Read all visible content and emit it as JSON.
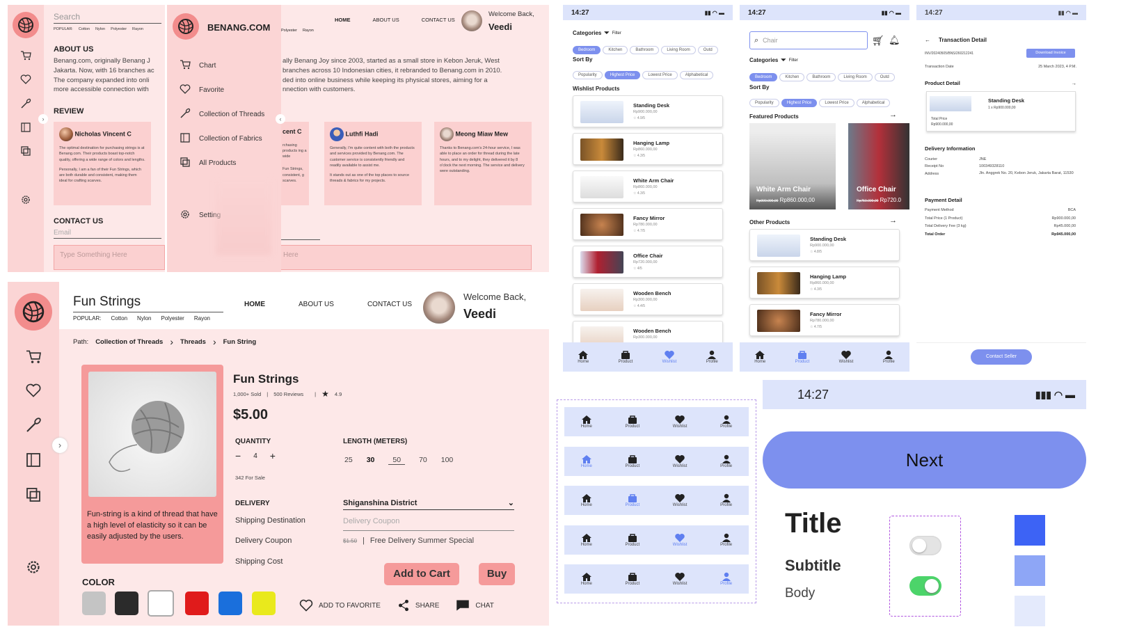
{
  "colors": {
    "pink_sidebar": "#fbd5d5",
    "pink_bg": "#fde8e8",
    "logo": "#f28c8c",
    "accent_blue": "#7d90ee",
    "nav_bg": "#dde4fb",
    "button_red": "#f59a9a"
  },
  "p1": {
    "search_placeholder": "Search",
    "popular": [
      "POPULAR:",
      "Cotton",
      "Nylon",
      "Polyester",
      "Rayon"
    ],
    "about_title": "ABOUT US",
    "about_text": "Benang.com, originally Benang J",
    "about_text2": "Jakarta. Now, with 16 branches ac",
    "about_text3": "The company expanded into onli",
    "about_text4": "more accessible connection with",
    "review_title": "REVIEW",
    "reviewer1": "Nicholas Vincent C",
    "review1_text": "The optimal destination for purchasing strings is at Benang.com. Their products boast top-notch quality, offering a wide range of colors and lengths.",
    "review1_text2": "Personally, I am a fan of their Fun Strings, which are both durable and consistent, making them ideal for crafting scarves.",
    "contact_title": "CONTACT US",
    "email_placeholder": "Email",
    "message_placeholder": "Type Something Here"
  },
  "p2": {
    "brand": "BENANG.COM",
    "menu": [
      "Chart",
      "Favorite",
      "Collection of Threads",
      "Collection of Fabrics",
      "All Products"
    ],
    "setting": "Setting",
    "popular": [
      "Polyester",
      "Rayon"
    ],
    "nav": [
      "HOME",
      "ABOUT US",
      "CONTACT US"
    ],
    "welcome": "Welcome Back,",
    "user": "Veedi",
    "about_text": "ally Benang Joy since 2003, started as a small store in Kebon Jeruk, West",
    "about_text2": "branches across 10 Indonesian cities, it rebranded to Benang.com in 2010.",
    "about_text3": "ded into online business while keeping its physical stores, aiming for a",
    "about_text4": "nnection with customers.",
    "reviewer_partial": "cent C",
    "review_partial_text": "rchasing products ing a wide",
    "review_partial_text2": "Fun Strings, consistent, g scarves.",
    "reviewer2": "Luthfi Hadi",
    "review2_text": "Generally, I'm quite content with both the products and services provided by Benang.com. The customer service is consistently friendly and readily available to assist me.",
    "review2_text2": "It stands out as one of the top places to source threads & fabrics for my projects.",
    "reviewer3": "Meong Miaw Mew",
    "review3_text": "Thanks to Benang.com's 24-hour service, I was able to place an order for thread during the late hours, and to my delight, they delivered it by 8 o'clock the next morning. The service and delivery were outstanding.",
    "message_partial": "Here"
  },
  "p3": {
    "brand": "Fun Strings",
    "popular": [
      "POPULAR:",
      "Cotton",
      "Nylon",
      "Polyester",
      "Rayon"
    ],
    "nav": [
      "HOME",
      "ABOUT US",
      "CONTACT US"
    ],
    "welcome": "Welcome Back,",
    "user": "Veedi",
    "path_label": "Path:",
    "path": [
      "Collection of Threads",
      "Threads",
      "Fun String"
    ],
    "product_name": "Fun Strings",
    "sold": "1,000+ Sold",
    "reviews": "500 Reviews",
    "rating": "4.9",
    "price": "$5.00",
    "description": "Fun-string is a kind of thread that have a high level of elasticity so it can be easily adjusted by the users.",
    "quantity_label": "QUANTITY",
    "quantity": "4",
    "stock": "342 For Sale",
    "length_label": "LENGTH (METERS)",
    "lengths": [
      "25",
      "30",
      "50",
      "70",
      "100"
    ],
    "length_selected": "30",
    "delivery_label": "DELIVERY",
    "shipping_destination": "Shipping Destination",
    "delivery_coupon": "Delivery Coupon",
    "shipping_cost": "Shipping Cost",
    "district": "Shiganshina District",
    "coupon_placeholder": "Delivery Coupon",
    "old_cost": "$1.50",
    "free_delivery": "Free Delivery Summer Special",
    "add_to_cart": "Add to Cart",
    "buy": "Buy",
    "color_label": "COLOR",
    "colors": [
      "#c4c4c4",
      "#2b2b2b",
      "#ffffff",
      "#e01b1b",
      "#1a6fdc",
      "#e9e91c"
    ],
    "add_favorite": "ADD TO FAVORITE",
    "share": "SHARE",
    "chat": "CHAT"
  },
  "m1": {
    "time": "14:27",
    "categories": "Categories",
    "filter": "Filter",
    "cat_chips": [
      "Bedroom",
      "Kitchen",
      "Bathroom",
      "Living Room",
      "Outd"
    ],
    "sort": "Sort By",
    "sort_chips": [
      "Popularity",
      "Highest Price",
      "Lowest Price",
      "Alphabetical"
    ],
    "section": "Wishlist Products",
    "products": [
      {
        "name": "Standing Desk",
        "price": "Rp900.000,00",
        "rate": "4.9/5"
      },
      {
        "name": "Hanging Lamp",
        "price": "Rp860.000,00",
        "rate": "4.3/5"
      },
      {
        "name": "White Arm Chair",
        "price": "Rp860.000,00",
        "rate": "4.3/5"
      },
      {
        "name": "Fancy Mirror",
        "price": "Rp780.000,00",
        "rate": "4.7/5"
      },
      {
        "name": "Office Chair",
        "price": "Rp720.000,00",
        "rate": "4/5"
      },
      {
        "name": "Wooden Bench",
        "price": "Rp300.000,00",
        "rate": "4.4/5"
      },
      {
        "name": "Wooden Bench",
        "price": "Rp300.000,00",
        "rate": ""
      }
    ],
    "nav": [
      "Home",
      "Product",
      "Wishlist",
      "Profile"
    ]
  },
  "m2": {
    "time": "14:27",
    "search_value": "Chair",
    "categories": "Categories",
    "filter": "Filter",
    "cat_chips": [
      "Bedroom",
      "Kitchen",
      "Bathroom",
      "Living Room",
      "Outd"
    ],
    "sort": "Sort By",
    "sort_chips": [
      "Popularity",
      "Highest Price",
      "Lowest Price",
      "Alphabetical"
    ],
    "featured": "Featured Products",
    "feat1_name": "White Arm Chair",
    "feat1_old": "Rp900.000,00",
    "feat1_price": "Rp860.000,00",
    "feat2_name": "Office Chair",
    "feat2_old": "Rp750.000,00",
    "feat2_price": "Rp720.0",
    "other": "Other Products",
    "products": [
      {
        "name": "Standing Desk",
        "price": "Rp900.000,00",
        "rate": "4.8/5"
      },
      {
        "name": "Hanging Lamp",
        "price": "Rp860.000,00",
        "rate": "4.3/5"
      },
      {
        "name": "Fancy Mirror",
        "price": "Rp780.000,00",
        "rate": "4.7/5"
      }
    ],
    "nav": [
      "Home",
      "Product",
      "Wishlist",
      "Profile"
    ]
  },
  "m3": {
    "time": "14:27",
    "title": "Transaction Detail",
    "invoice_no": "INV/20240505/BNS/260212241",
    "download": "Download Invoice",
    "trans_date_label": "Transaction Date",
    "trans_date": "25 March 2023, 4 P.M.",
    "product_detail": "Product Detail",
    "product_name": "Standing Desk",
    "product_qty": "1 x Rp900.000,00",
    "total_price_label": "Total Price",
    "total_price": "Rp900.000,00",
    "delivery_info": "Delivery Information",
    "courier_label": "Courier",
    "courier": "JNE",
    "receipt_label": "Receipt No",
    "receipt": "100349328110",
    "address_label": "Address",
    "address": "Jln. Anggrek No. 20, Kebon Jeruk, Jakarta Barat, 11530",
    "payment_detail": "Payment Detail",
    "pay_method_label": "Payment Method",
    "pay_method": "BCA",
    "total_price_row_label": "Total Price (1 Product)",
    "total_price_row": "Rp900.000,00",
    "delivery_fee_label": "Total Delivery Fee (3 kg)",
    "delivery_fee": "Rp45.000,00",
    "total_order_label": "Total Order",
    "total_order": "Rp945.000,00",
    "contact_seller": "Contact Seller"
  },
  "navvariants": {
    "labels": [
      "Home",
      "Product",
      "Wishlist",
      "Profile"
    ],
    "active": [
      -1,
      0,
      1,
      2,
      3
    ]
  },
  "components": {
    "time": "14:27",
    "next": "Next",
    "title": "Title",
    "subtitle": "Subtitle",
    "body": "Body",
    "blues": [
      "#3d63f5",
      "#8ea6f6",
      "#e4eafc"
    ]
  }
}
